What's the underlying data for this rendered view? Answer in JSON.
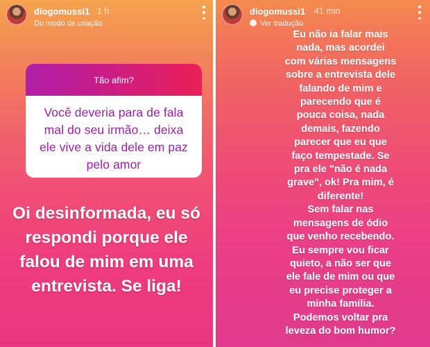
{
  "left_story": {
    "username": "diogomussi1",
    "time": "1 h",
    "subtitle": "Do modo de criação",
    "question_box": {
      "header": "Tão afim?",
      "lines": [
        "Você deveria para de fala",
        "mal do seu irmão… deixa",
        "ele vive a vida dele em paz",
        "pelo amor"
      ]
    },
    "answer_lines": [
      "Oi desinformada, eu só",
      "respondi porque ele",
      "falou de mim em uma",
      "entrevista. Se liga!"
    ]
  },
  "right_story": {
    "username": "diogomussi1",
    "time": "41 min",
    "subtitle": "Ver tradução",
    "text_lines": [
      "Eu não ia falar mais",
      "nada, mas acordei",
      "com várias mensagens",
      "sobre a entrevista dele",
      "falando de mim e",
      "parecendo que é",
      "pouca coisa, nada",
      "demais, fazendo",
      "parecer que eu que",
      "faço tempestade. Se",
      "pra ele \"não é nada",
      "grave\", ok! Pra mim, é",
      "diferente!",
      "Sem falar nas",
      "mensagens de ódio",
      "que venho recebendo.",
      "Eu sempre vou ficar",
      "quieto, a não ser que",
      "ele fale de mim ou que",
      "eu precise proteger a",
      "minha família.",
      "Podemos voltar pra",
      "leveza do bom humor?"
    ]
  },
  "icons": {
    "more": "more-options-icon",
    "translate": "translate-icon",
    "avatar": "avatar"
  }
}
